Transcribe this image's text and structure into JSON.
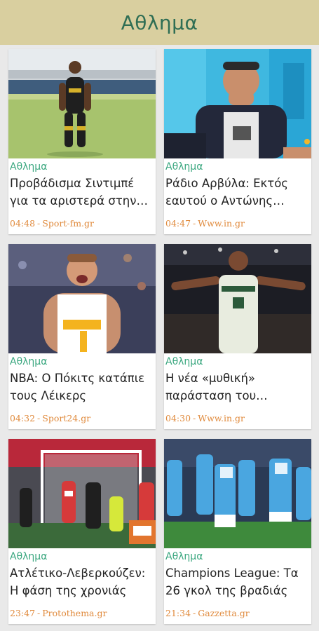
{
  "appbar": {
    "title": "Αθλημα"
  },
  "articles": [
    {
      "category": "Αθλημα",
      "headline": "Προβάδισμα Σιντιμπέ για τα αριστερά στην ΑΕΚ",
      "time": "04:48",
      "source": "Sport-fm.gr",
      "image": "soccer-player-photo"
    },
    {
      "category": "Αθλημα",
      "headline": "Ράδιο Αρβύλα: Εκτός εαυτού ο Αντώνης Κανάκης",
      "time": "04:47",
      "source": "Www.in.gr",
      "image": "tv-host-photo"
    },
    {
      "category": "Αθλημα",
      "headline": "NBA: Ο Πόκιτς κατάπιε τους Λέικερς",
      "time": "04:32",
      "source": "Sport24.gr",
      "image": "basketball-player-photo"
    },
    {
      "category": "Αθλημα",
      "headline": "Η νέα «μυθική» παράσταση του Αντετοκούνμπο",
      "time": "04:30",
      "source": "Www.in.gr",
      "image": "bucks-player-photo"
    },
    {
      "category": "Αθλημα",
      "headline": "Ατλέτικο-Λεβερκούζεν: Η φάση της χρονιάς",
      "time": "23:47",
      "source": "Protothema.gr",
      "image": "goalmouth-action-photo"
    },
    {
      "category": "Αθλημα",
      "headline": "Champions League: Τα 26 γκολ της βραδιάς",
      "time": "21:34",
      "source": "Gazzetta.gr",
      "image": "napoli-celebration-photo"
    }
  ]
}
